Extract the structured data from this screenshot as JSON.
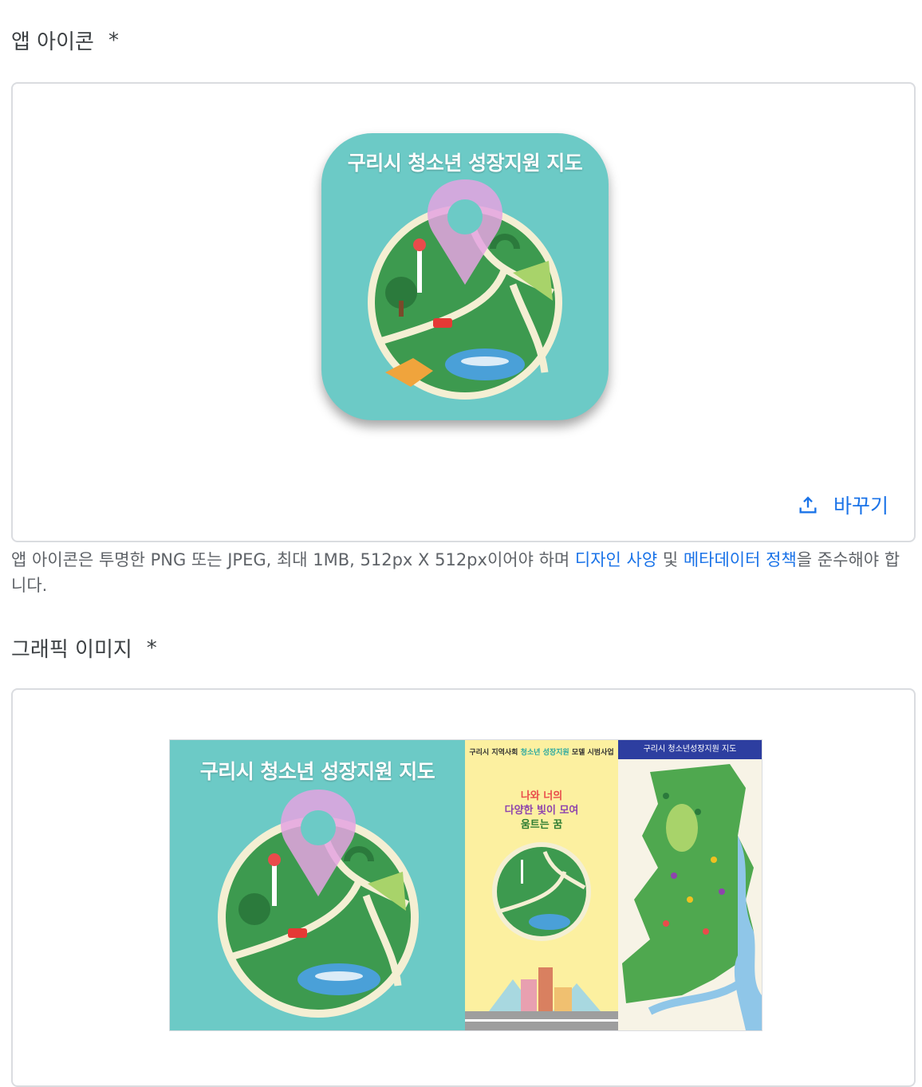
{
  "app_icon_section": {
    "title": "앱 아이콘",
    "required_mark": "*",
    "icon_title": "구리시 청소년 성장지원 지도",
    "replace_label": "바꾸기"
  },
  "helper": {
    "text_before": "앱 아이콘은 투명한 PNG 또는 JPEG, 최대 1MB, 512px X 512px이어야 하며 ",
    "link_design": "디자인 사양",
    "text_and": " 및 ",
    "link_metadata": "메타데이터 정책",
    "text_after": "을 준수해야 합니다."
  },
  "graphic_section": {
    "title": "그래픽 이미지",
    "required_mark": "*",
    "feature_title": "구리시 청소년 성장지원 지도",
    "panel_b_top_1": "구리시 지역사회 ",
    "panel_b_top_green": "청소년 성장지원",
    "panel_b_top_2": " 모델 시범사업",
    "panel_b_line1": "나와 너의",
    "panel_b_line2": "다양한 빛이 모여",
    "panel_b_line3": "움트는 꿈",
    "panel_c_header": "구리시 청소년성장지원 지도"
  },
  "colors": {
    "teal": "#6ccac6",
    "grass": "#3d9a4f",
    "pin": "#e4a3e0",
    "link": "#1a73e8"
  }
}
